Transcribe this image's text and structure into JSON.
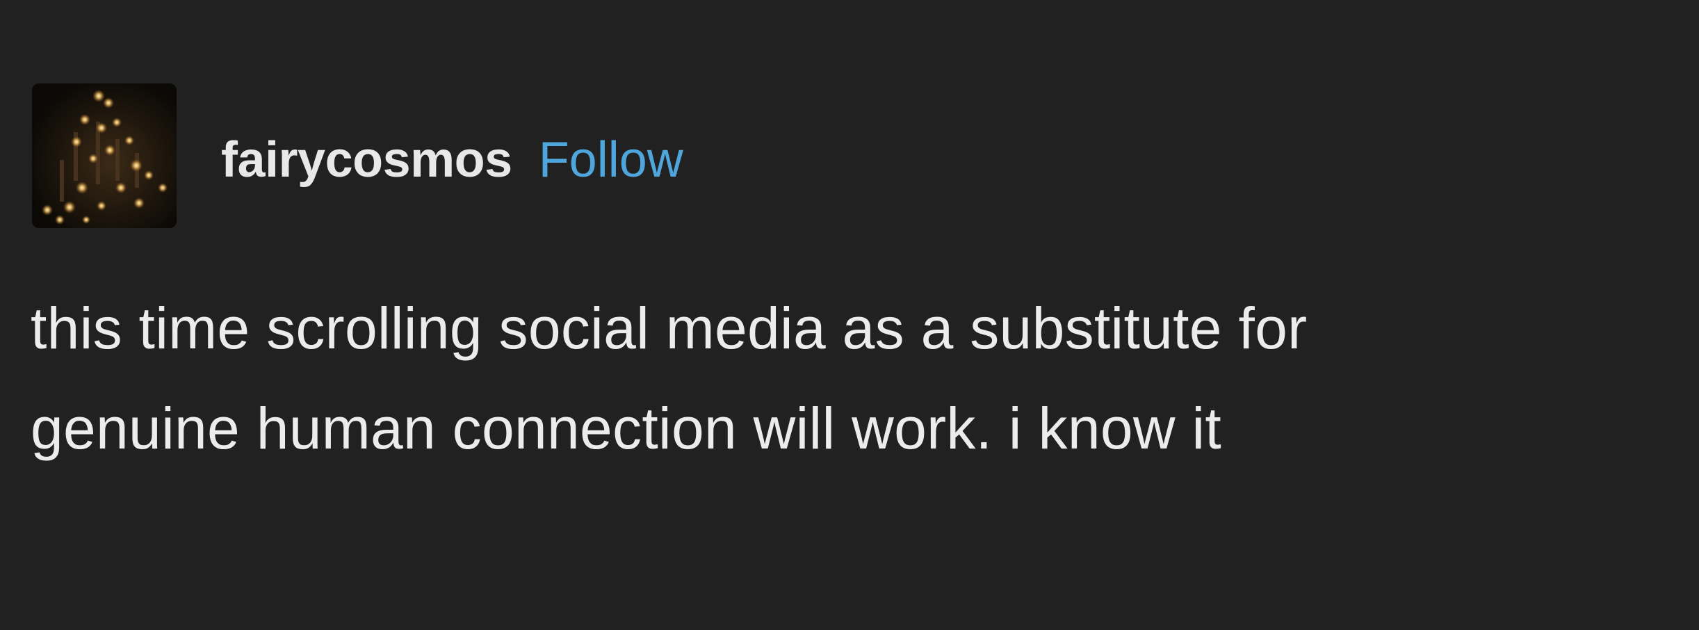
{
  "post": {
    "author": {
      "username": "fairycosmos",
      "follow_label": "Follow",
      "avatar_icon": "candles-avatar"
    },
    "body": {
      "lines": [
        "this time scrolling social media as a substitute for",
        "genuine human connection will work. i know it"
      ]
    },
    "colors": {
      "background": "#212121",
      "text": "#ececec",
      "follow": "#4fa6dc"
    }
  }
}
